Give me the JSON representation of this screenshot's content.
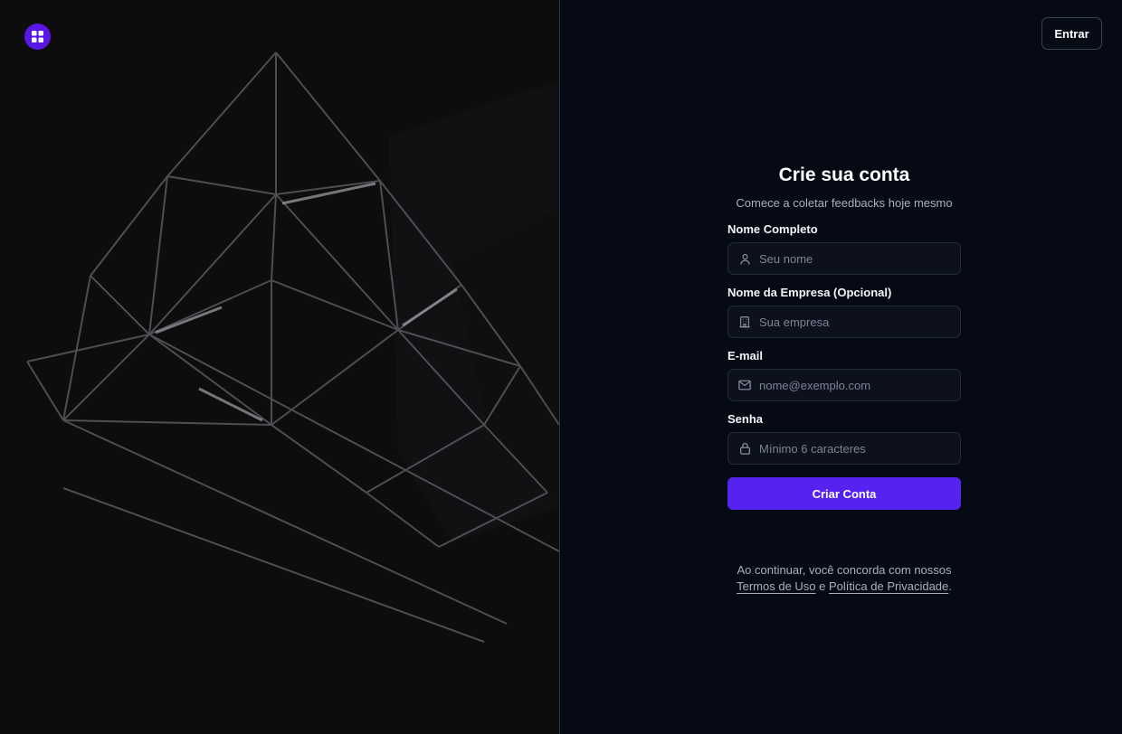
{
  "header": {
    "login_label": "Entrar"
  },
  "form": {
    "title": "Crie sua conta",
    "subtitle": "Comece a coletar feedbacks hoje mesmo",
    "fields": [
      {
        "label": "Nome Completo",
        "placeholder": "Seu nome",
        "icon": "user-icon"
      },
      {
        "label": "Nome da Empresa (Opcional)",
        "placeholder": "Sua empresa",
        "icon": "building-icon"
      },
      {
        "label": "E-mail",
        "placeholder": "nome@exemplo.com",
        "icon": "mail-icon"
      },
      {
        "label": "Senha",
        "placeholder": "Mínimo 6 caracteres",
        "icon": "lock-icon"
      }
    ],
    "submit_label": "Criar Conta"
  },
  "legal": {
    "prefix": "Ao continuar, você concorda com nossos",
    "terms_label": "Termos de Uso",
    "conjunction": "e",
    "privacy_label": "Política de Privacidade",
    "suffix": "."
  },
  "colors": {
    "accent": "#5522f0",
    "logo": "#5a16e6",
    "background": "#060a15",
    "left_panel": "#0d0d0e"
  },
  "logo_icon": "grid-icon"
}
